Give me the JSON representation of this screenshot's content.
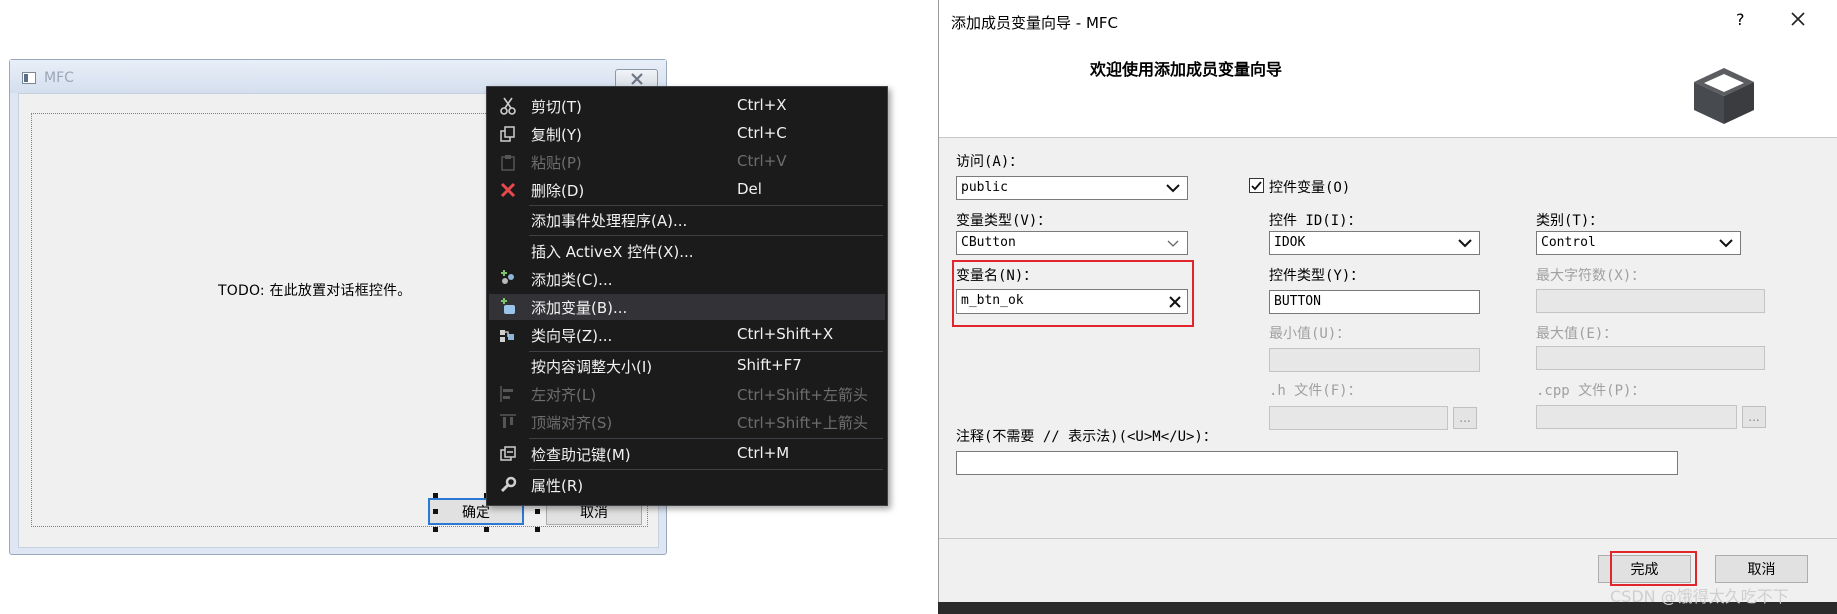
{
  "designer": {
    "window_title": "MFC",
    "todo_text": "TODO:  在此放置对话框控件。",
    "ok_button": "确定",
    "cancel_button": "取消"
  },
  "context_menu": {
    "items": [
      {
        "label": "剪切(T)",
        "shortcut": "Ctrl+X",
        "icon": "scissors-icon",
        "enabled": true
      },
      {
        "label": "复制(Y)",
        "shortcut": "Ctrl+C",
        "icon": "copy-icon",
        "enabled": true
      },
      {
        "label": "粘贴(P)",
        "shortcut": "Ctrl+V",
        "icon": "paste-icon",
        "enabled": false
      },
      {
        "label": "删除(D)",
        "shortcut": "Del",
        "icon": "delete-icon",
        "enabled": true
      },
      {
        "label": "添加事件处理程序(A)...",
        "shortcut": "",
        "icon": "",
        "enabled": true
      },
      {
        "label": "插入 ActiveX 控件(X)...",
        "shortcut": "",
        "icon": "",
        "enabled": true
      },
      {
        "label": "添加类(C)...",
        "shortcut": "",
        "icon": "add-class-icon",
        "enabled": true
      },
      {
        "label": "添加变量(B)...",
        "shortcut": "",
        "icon": "add-variable-icon",
        "enabled": true,
        "highlighted": true
      },
      {
        "label": "类向导(Z)...",
        "shortcut": "Ctrl+Shift+X",
        "icon": "class-wizard-icon",
        "enabled": true
      },
      {
        "label": "按内容调整大小(I)",
        "shortcut": "Shift+F7",
        "icon": "",
        "enabled": true
      },
      {
        "label": "左对齐(L)",
        "shortcut": "Ctrl+Shift+左箭头",
        "icon": "align-left-icon",
        "enabled": false
      },
      {
        "label": "顶端对齐(S)",
        "shortcut": "Ctrl+Shift+上箭头",
        "icon": "align-top-icon",
        "enabled": false
      },
      {
        "label": "检查助记键(M)",
        "shortcut": "Ctrl+M",
        "icon": "mnemonic-icon",
        "enabled": true
      },
      {
        "label": "属性(R)",
        "shortcut": "",
        "icon": "wrench-icon",
        "enabled": true
      }
    ]
  },
  "wizard": {
    "title": "添加成员变量向导 - MFC",
    "help": "?",
    "heading": "欢迎使用添加成员变量向导",
    "access_label": "访问(A)：",
    "access_value": "public",
    "control_var_label": "控件变量(O)",
    "control_var_checked": true,
    "var_type_label": "变量类型(V)：",
    "var_type_value": "CButton",
    "control_id_label": "控件 ID(I)：",
    "control_id_value": "IDOK",
    "category_label": "类别(T)：",
    "category_value": "Control",
    "var_name_label": "变量名(N)：",
    "var_name_value": "m_btn_ok",
    "control_type_label": "控件类型(Y)：",
    "control_type_value": "BUTTON",
    "max_chars_label": "最大字符数(X)：",
    "min_value_label": "最小值(U)：",
    "max_value_label": "最大值(E)：",
    "h_file_label": ".h 文件(F)：",
    "cpp_file_label": ".cpp 文件(P)：",
    "browse_label": "...",
    "comment_label": "注释(不需要 // 表示法)(<U>M</U>)：",
    "comment_value": "",
    "finish_button": "完成",
    "cancel_button": "取消"
  },
  "watermark": "CSDN @饿得太久吃不下"
}
